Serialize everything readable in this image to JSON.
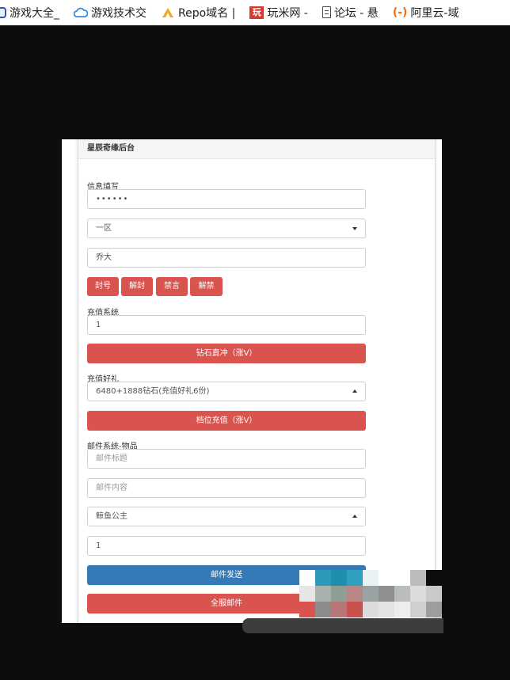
{
  "bookmarks": [
    {
      "label": "游戏大全_",
      "icon": "gamepad-icon"
    },
    {
      "label": "游戏技术交",
      "icon": "cloud-icon"
    },
    {
      "label": "Repo域名 |",
      "icon": "repo-icon"
    },
    {
      "label": "玩米网 -",
      "icon": "wanmi-icon",
      "badge": "玩"
    },
    {
      "label": "论坛 - 悬",
      "icon": "document-icon"
    },
    {
      "label": "阿里云-域",
      "icon": "aliyun-icon",
      "badge": "(-)"
    }
  ],
  "panel": {
    "title": "星辰奇缘后台",
    "info_label": "信息填写",
    "password_value": "••••••",
    "server_select": "一区",
    "player_name": "乔大",
    "action_buttons": [
      "封号",
      "解封",
      "禁言",
      "解禁"
    ],
    "recharge_label": "充值系统",
    "recharge_amount": "1",
    "diamond_button": "钻石直冲（涨V）",
    "gift_label": "充值好礼",
    "gift_select": "6480+1888钻石(充值好礼6份)",
    "tier_button": "档位充值（涨V）",
    "mail_label": "邮件系统-物品",
    "mail_title_placeholder": "邮件标题",
    "mail_content_placeholder": "邮件内容",
    "item_select": "鲸鱼公主",
    "item_quantity": "1",
    "send_mail_button": "邮件发送",
    "server_mail_button": "全服邮件"
  },
  "colors": {
    "danger": "#d9534f",
    "primary": "#337ab7",
    "background": "#0d0d0d"
  }
}
